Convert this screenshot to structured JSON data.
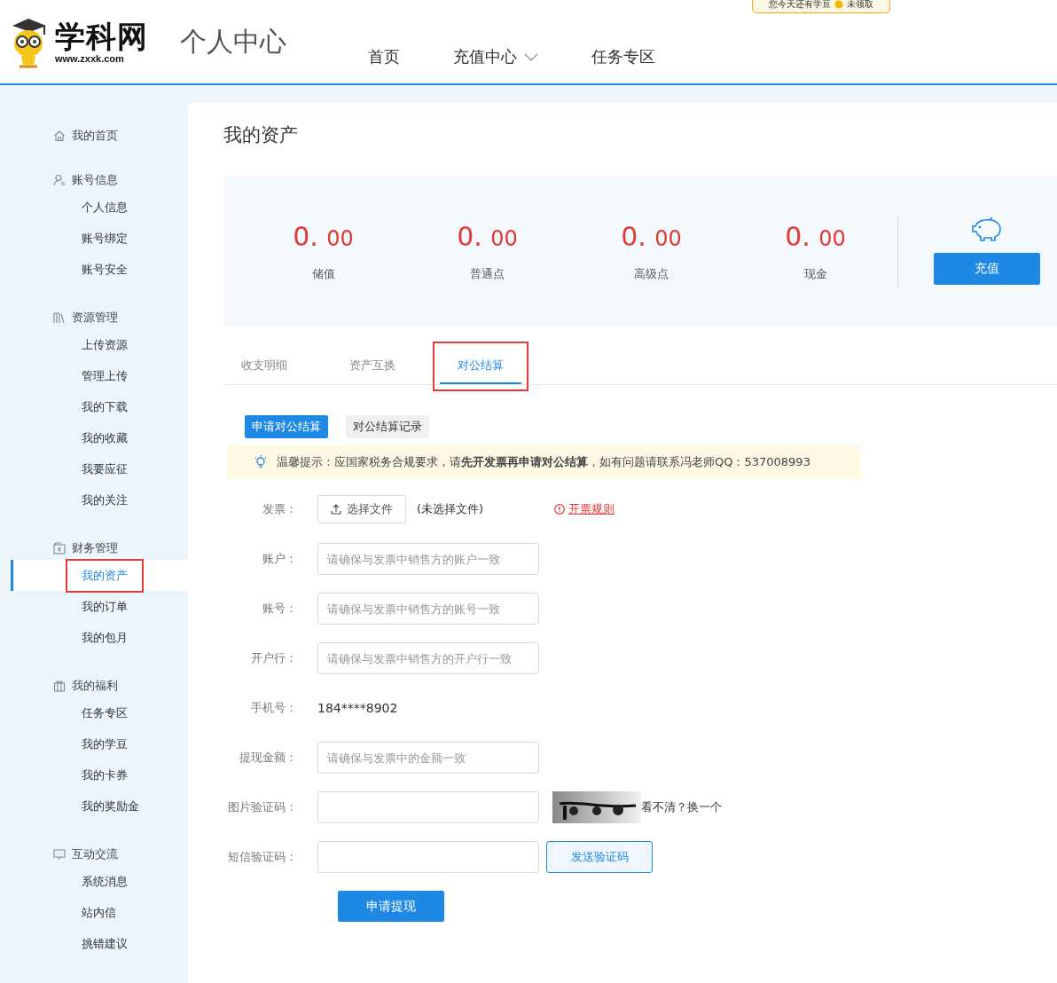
{
  "header": {
    "logo_text": "学科网",
    "logo_url": "www.zxxk.com",
    "page_title": "个人中心",
    "nav": [
      {
        "label": "首页",
        "dropdown": false
      },
      {
        "label": "充值中心",
        "dropdown": true
      },
      {
        "label": "任务专区",
        "dropdown": false
      }
    ],
    "promo": {
      "before": "您今天还有学豆",
      "after": "未领取"
    }
  },
  "sidebar": [
    {
      "label": "我的首页"
    },
    {
      "label": "账号信息",
      "children": [
        {
          "label": "个人信息",
          "selected": false,
          "annotated": false
        },
        {
          "label": "账号绑定",
          "selected": false,
          "annotated": false
        },
        {
          "label": "账号安全",
          "selected": false,
          "annotated": false
        }
      ]
    },
    {
      "label": "资源管理",
      "children": [
        {
          "label": "上传资源",
          "selected": false,
          "annotated": false
        },
        {
          "label": "管理上传",
          "selected": false,
          "annotated": false
        },
        {
          "label": "我的下载",
          "selected": false,
          "annotated": false
        },
        {
          "label": "我的收藏",
          "selected": false,
          "annotated": false
        },
        {
          "label": "我要应征",
          "selected": false,
          "annotated": false
        },
        {
          "label": "我的关注",
          "selected": false,
          "annotated": false
        }
      ]
    },
    {
      "label": "财务管理",
      "children": [
        {
          "label": "我的资产",
          "selected": true,
          "annotated": true
        },
        {
          "label": "我的订单",
          "selected": false,
          "annotated": false
        },
        {
          "label": "我的包月",
          "selected": false,
          "annotated": false
        }
      ]
    },
    {
      "label": "我的福利",
      "children": [
        {
          "label": "任务专区",
          "selected": false,
          "annotated": false
        },
        {
          "label": "我的学豆",
          "selected": false,
          "annotated": false
        },
        {
          "label": "我的卡券",
          "selected": false,
          "annotated": false
        },
        {
          "label": "我的奖励金",
          "selected": false,
          "annotated": false
        }
      ]
    },
    {
      "label": "互动交流",
      "children": [
        {
          "label": "系统消息",
          "selected": false,
          "annotated": false
        },
        {
          "label": "站内信",
          "selected": false,
          "annotated": false
        },
        {
          "label": "挑错建议",
          "selected": false,
          "annotated": false
        }
      ]
    }
  ],
  "main": {
    "title": "我的资产",
    "assets": [
      {
        "int": "0.",
        "dec": "00",
        "label": "储值"
      },
      {
        "int": "0.",
        "dec": "00",
        "label": "普通点"
      },
      {
        "int": "0.",
        "dec": "00",
        "label": "高级点"
      },
      {
        "int": "0.",
        "dec": "00",
        "label": "现金"
      }
    ],
    "recharge_button": "充值",
    "tabs": [
      {
        "label": "收支明细",
        "selected": false,
        "annotated": false
      },
      {
        "label": "资产互换",
        "selected": false,
        "annotated": false
      },
      {
        "label": "对公结算",
        "selected": true,
        "annotated": true
      }
    ],
    "subtabs": [
      {
        "label": "申请对公结算",
        "selected": true
      },
      {
        "label": "对公结算记录",
        "selected": false
      }
    ],
    "notice": "温馨提示：应国家税务合规要求，请**先开发票再申请对公结算**，如有问题请联系冯老师QQ：537008993",
    "form": [
      {
        "kind": "file",
        "label": "发票：",
        "button": "选择文件",
        "status": "(未选择文件)",
        "link": "开票规则"
      },
      {
        "kind": "input",
        "label": "账户：",
        "placeholder": "请确保与发票中销售方的账户一致"
      },
      {
        "kind": "input",
        "label": "账号：",
        "placeholder": "请确保与发票中销售方的账号一致"
      },
      {
        "kind": "input",
        "label": "开户行：",
        "placeholder": "请确保与发票中销售方的开户行一致"
      },
      {
        "kind": "text",
        "label": "手机号：",
        "value": "184****8902"
      },
      {
        "kind": "input",
        "label": "提现金额：",
        "placeholder": "请确保与发票中的金额一致"
      },
      {
        "kind": "captcha",
        "label": "图片验证码：",
        "refresh": "看不清？换一个"
      },
      {
        "kind": "sms",
        "label": "短信验证码：",
        "button": "发送验证码"
      }
    ],
    "submit": "申请提现"
  }
}
